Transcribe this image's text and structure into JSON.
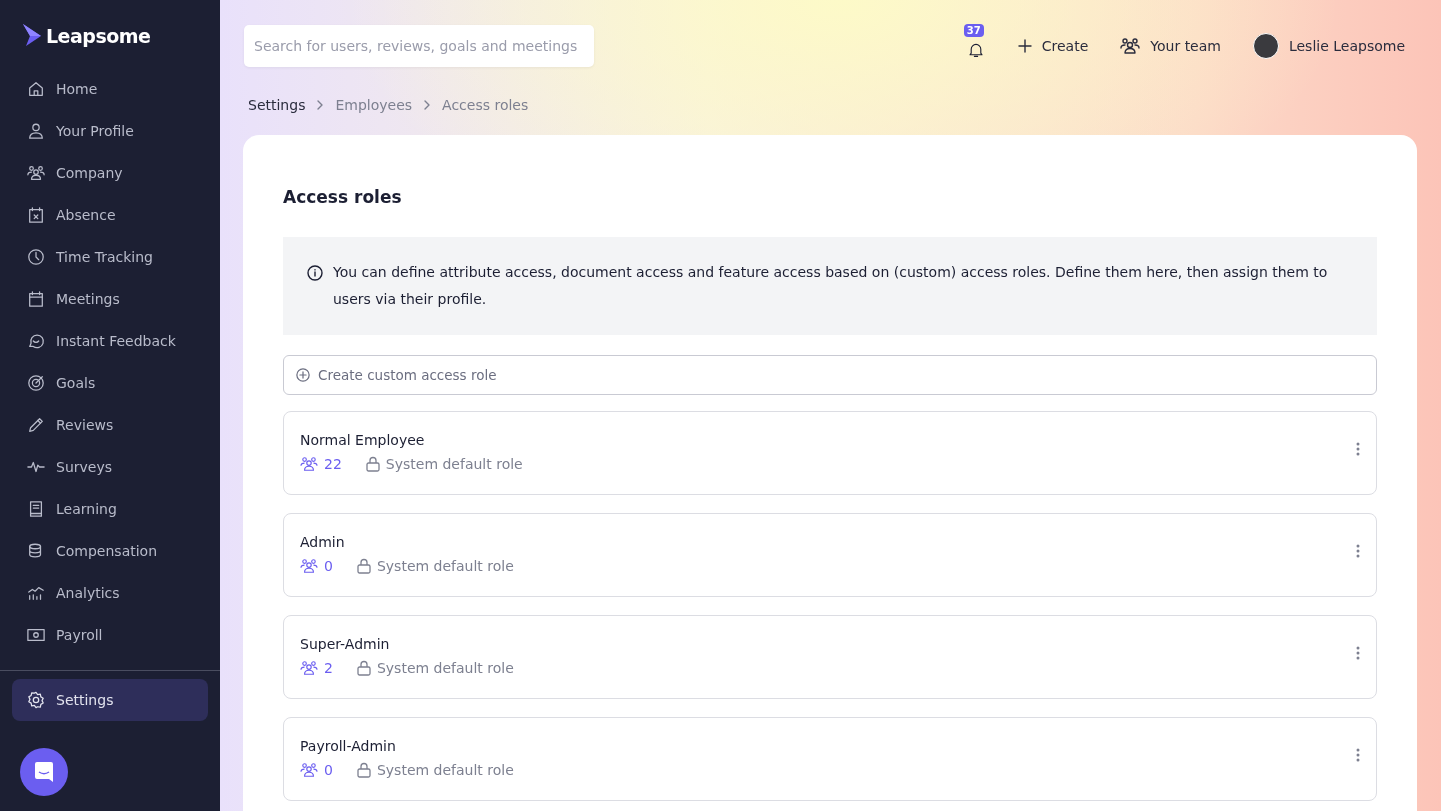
{
  "logo": {
    "text": "Leapsome"
  },
  "sidebar": {
    "items": [
      {
        "label": "Home",
        "selected": false
      },
      {
        "label": "Your Profile",
        "selected": false
      },
      {
        "label": "Company",
        "selected": false
      },
      {
        "label": "Absence",
        "selected": false
      },
      {
        "label": "Time Tracking",
        "selected": false
      },
      {
        "label": "Meetings",
        "selected": false
      },
      {
        "label": "Instant Feedback",
        "selected": false
      },
      {
        "label": "Goals",
        "selected": false
      },
      {
        "label": "Reviews",
        "selected": false
      },
      {
        "label": "Surveys",
        "selected": false
      },
      {
        "label": "Learning",
        "selected": false
      },
      {
        "label": "Compensation",
        "selected": false
      },
      {
        "label": "Analytics",
        "selected": false
      },
      {
        "label": "Payroll",
        "selected": false
      }
    ],
    "bottom_items": [
      {
        "label": "Settings",
        "selected": true
      }
    ]
  },
  "search": {
    "placeholder": "Search for users, reviews, goals and meetings"
  },
  "topbar": {
    "notifications_count": "37",
    "create": "Create",
    "team": "Your team",
    "user": "Leslie Leapsome"
  },
  "breadcrumbs": [
    "Settings",
    "Employees",
    "Access roles"
  ],
  "page": {
    "title": "Access roles",
    "info": "You can define attribute access, document access and feature access based on (custom) access roles. Define them here, then assign them to users via their profile.",
    "create_button": "Create custom access role",
    "roles": [
      {
        "name": "Normal Employee",
        "users": "22",
        "type": "System default role"
      },
      {
        "name": "Admin",
        "users": "0",
        "type": "System default role"
      },
      {
        "name": "Super-Admin",
        "users": "2",
        "type": "System default role"
      },
      {
        "name": "Payroll-Admin",
        "users": "0",
        "type": "System default role"
      }
    ]
  }
}
